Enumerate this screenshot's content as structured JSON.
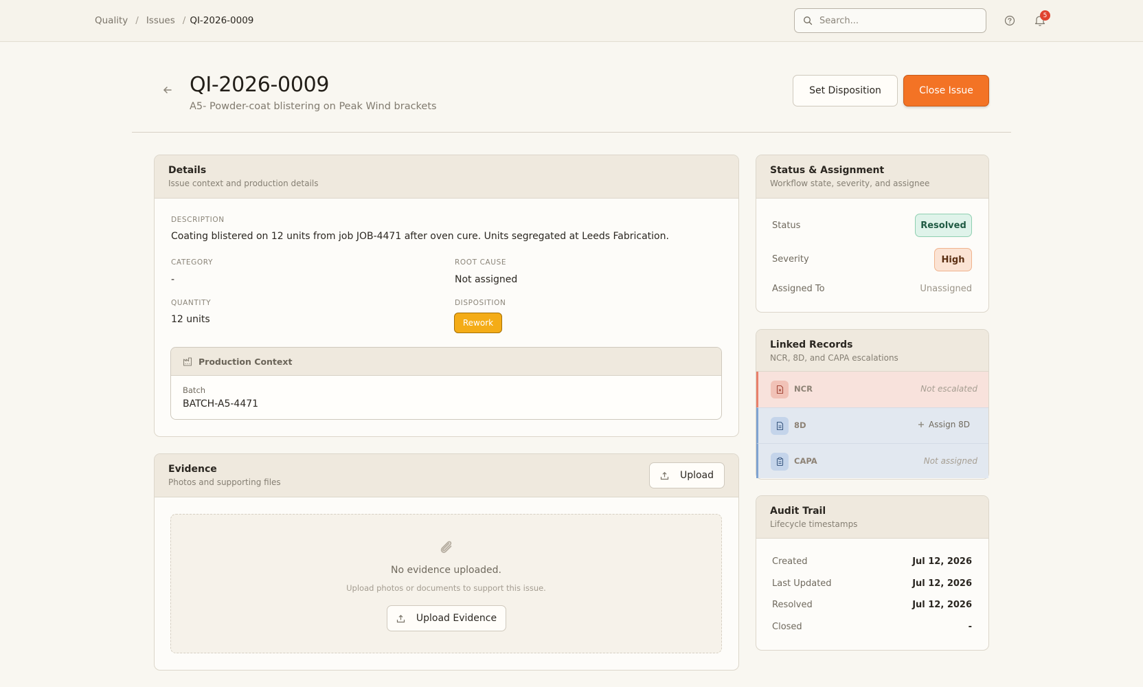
{
  "breadcrumb": {
    "items": [
      "Quality",
      "Issues",
      "QI-2026-0009"
    ],
    "separator": "/"
  },
  "search": {
    "placeholder": "Search..."
  },
  "notifications": {
    "count": "5"
  },
  "header": {
    "title": "QI-2026-0009",
    "subtitle": "A5- Powder-coat blistering on Peak Wind brackets",
    "set_disposition_label": "Set Disposition",
    "close_issue_label": "Close Issue"
  },
  "details": {
    "title": "Details",
    "subtitle": "Issue context and production details",
    "description_label": "DESCRIPTION",
    "description": "Coating blistered on 12 units from job JOB-4471 after oven cure. Units segregated at Leeds Fabrication.",
    "category_label": "CATEGORY",
    "category": "-",
    "root_cause_label": "ROOT CAUSE",
    "root_cause": "Not assigned",
    "quantity_label": "QUANTITY",
    "quantity": "12 units",
    "disposition_label": "DISPOSITION",
    "disposition": "Rework",
    "production_context": {
      "title": "Production Context",
      "batch_label": "Batch",
      "batch": "BATCH-A5-4471"
    }
  },
  "evidence": {
    "title": "Evidence",
    "subtitle": "Photos and supporting files",
    "upload_label": "Upload",
    "empty_title": "No evidence uploaded.",
    "empty_hint": "Upload photos or documents to support this issue.",
    "upload_evidence_label": "Upload Evidence"
  },
  "status_assignment": {
    "title": "Status & Assignment",
    "subtitle": "Workflow state, severity, and assignee",
    "status_label": "Status",
    "status": "Resolved",
    "severity_label": "Severity",
    "severity": "High",
    "assigned_label": "Assigned To",
    "assigned": "Unassigned"
  },
  "linked_records": {
    "title": "Linked Records",
    "subtitle": "NCR, 8D, and CAPA escalations",
    "items": [
      {
        "name": "NCR",
        "state": "Not escalated"
      },
      {
        "name": "8D",
        "action": "Assign 8D"
      },
      {
        "name": "CAPA",
        "state": "Not assigned"
      }
    ]
  },
  "audit_trail": {
    "title": "Audit Trail",
    "subtitle": "Lifecycle timestamps",
    "rows": [
      {
        "label": "Created",
        "value": "Jul 12, 2026"
      },
      {
        "label": "Last Updated",
        "value": "Jul 12, 2026"
      },
      {
        "label": "Resolved",
        "value": "Jul 12, 2026"
      },
      {
        "label": "Closed",
        "value": "-"
      }
    ]
  },
  "colors": {
    "accent": "#f37325",
    "rework": "#f4ac17",
    "resolved_bg": "#dff3ea",
    "high_bg": "#fbe3d4",
    "ncr_bg": "#f8e2dc",
    "link_bg": "#e2e8f0"
  },
  "icons": [
    "arrow-left-icon",
    "search-icon",
    "help-icon",
    "bell-icon",
    "factory-icon",
    "upload-icon",
    "paperclip-icon",
    "file-x-icon",
    "file-text-icon",
    "clipboard-icon",
    "plus-icon"
  ]
}
